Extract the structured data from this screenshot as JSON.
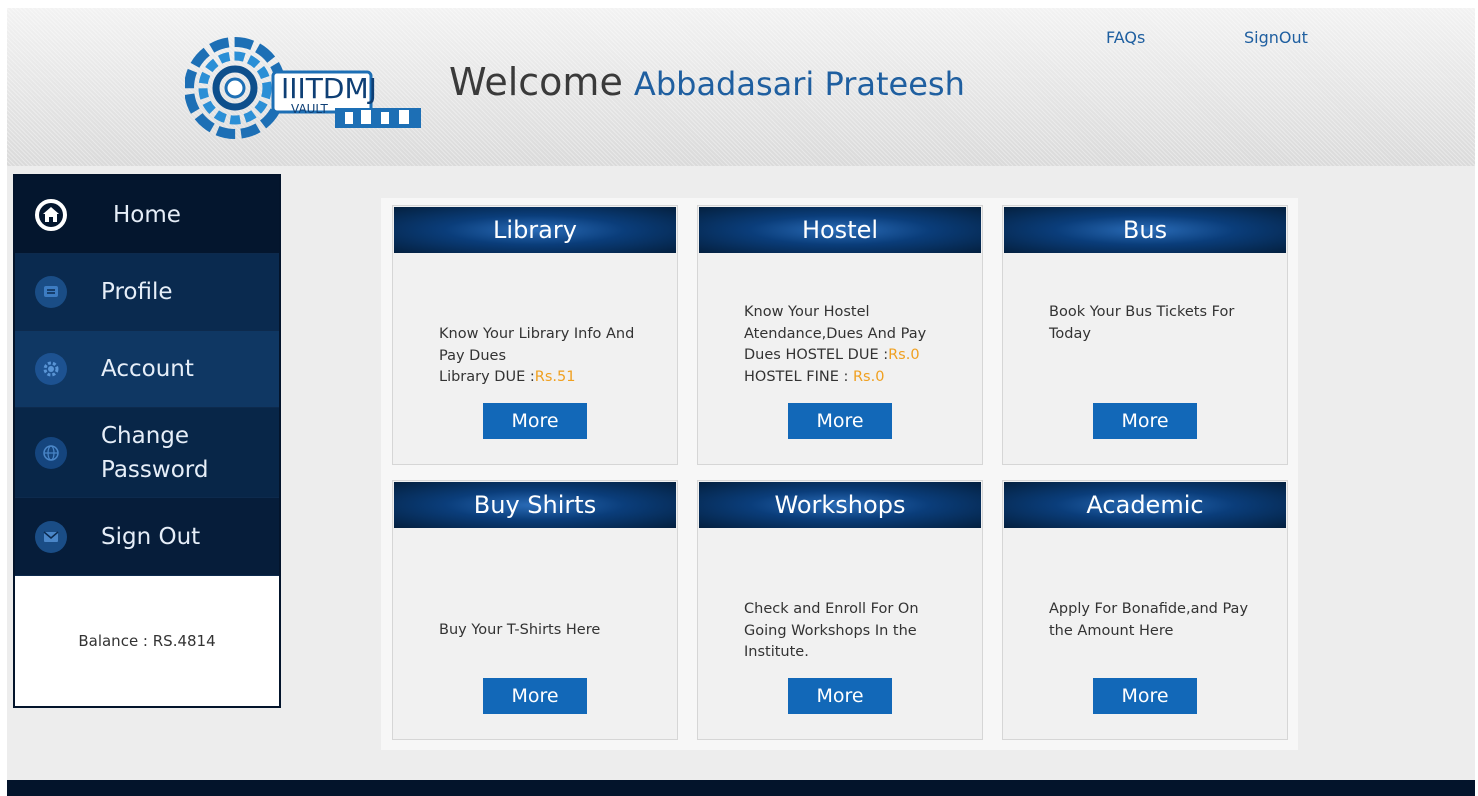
{
  "header": {
    "logo_text": "IIITDMJ",
    "logo_subtext": "VAULT",
    "welcome": "Welcome",
    "user_name": "Abbadasari Prateesh",
    "links": {
      "faqs": "FAQs",
      "signout": "SignOut"
    }
  },
  "sidebar": {
    "items": [
      {
        "label": "Home",
        "icon": "home-icon"
      },
      {
        "label": "Profile",
        "icon": "profile-icon"
      },
      {
        "label": "Account",
        "icon": "gear-icon"
      },
      {
        "label_line1": "Change",
        "label_line2": "Password",
        "icon": "globe-icon"
      },
      {
        "label": "Sign Out",
        "icon": "mail-icon"
      }
    ],
    "balance": "Balance : RS.4814"
  },
  "cards": [
    {
      "title": "Library",
      "desc_line1": "Know Your Library Info And",
      "desc_line2": "Pay Dues",
      "due_label": "Library DUE :",
      "due_value": "Rs.51",
      "button": "More"
    },
    {
      "title": "Hostel",
      "desc_line1": "Know Your Hostel",
      "desc_line2": "Atendance,Dues And Pay",
      "due_label": "Dues HOSTEL DUE :",
      "due_value": "Rs.0",
      "fine_label": "HOSTEL FINE : ",
      "fine_value": "Rs.0",
      "button": "More"
    },
    {
      "title": "Bus",
      "desc_line1": "Book Your Bus Tickets For",
      "desc_line2": "Today",
      "button": "More"
    },
    {
      "title": "Buy Shirts",
      "desc_line1": "Buy Your T-Shirts Here",
      "button": "More"
    },
    {
      "title": "Workshops",
      "desc_line1": "Check and Enroll For On",
      "desc_line2": "Going Workshops In the",
      "desc_line3": "Institute.",
      "button": "More"
    },
    {
      "title": "Academic",
      "desc_line1": "Apply For Bonafide,and Pay",
      "desc_line2": "the Amount Here",
      "button": "More"
    }
  ],
  "colors": {
    "nav_dark": "#03142b",
    "accent_blue": "#1268b8",
    "amount_orange": "#f0a020",
    "link_blue": "#1f5fa0"
  }
}
